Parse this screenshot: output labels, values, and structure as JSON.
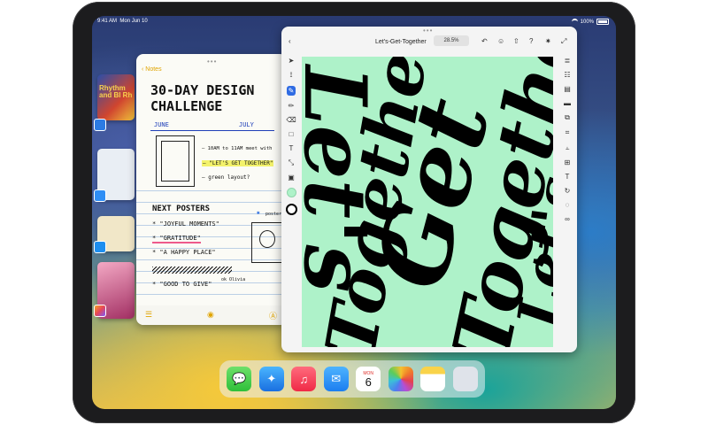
{
  "status_bar": {
    "time": "9:41 AM",
    "date": "Mon Jun 10",
    "battery": "100%"
  },
  "stage_manager": {
    "thumb1_text": "Rhythm and Bl Rh"
  },
  "notes": {
    "back_label": "Notes",
    "title_line1": "30-DAY DESIGN",
    "title_line2": "CHALLENGE",
    "month_left": "JUNE",
    "month_right": "JULY",
    "task1": "– 10AM to 11AM meet with",
    "task2": "– \"LET'S GET TOGETHER\"",
    "task3": "– green layout?",
    "next_posters": "NEXT POSTERS",
    "poster1": "* \"JOYFUL MOMENTS\"",
    "poster2": "* \"GRATITUDE\"",
    "poster3": "* \"A HAPPY PLACE\"",
    "poster4": "* \"GOOD TO GIVE\"",
    "poster_label": "poster",
    "signature": "ok Olivia"
  },
  "canvas": {
    "doc_title": "Let's-Get-Together",
    "zoom": "28.5%",
    "art_text": "Let's Get Together",
    "accent_color": "#aef2c9"
  },
  "dock": {
    "apps": [
      "Messages",
      "Safari",
      "Music",
      "Mail",
      "Calendar",
      "Photos",
      "Notes",
      "Utilities"
    ],
    "calendar_day_name": "MON",
    "calendar_day": "6"
  }
}
